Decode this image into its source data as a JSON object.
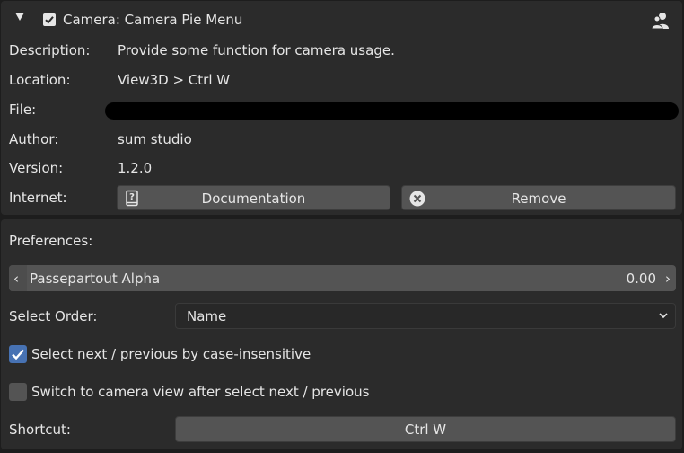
{
  "header": {
    "title": "Camera: Camera Pie Menu",
    "expanded": true,
    "enabled": true,
    "right_icon": "users-icon"
  },
  "info": {
    "description": {
      "label": "Description:",
      "value": "Provide some function for camera usage."
    },
    "location": {
      "label": "Location:",
      "value": "View3D > Ctrl W"
    },
    "file": {
      "label": "File:"
    },
    "author": {
      "label": "Author:",
      "value": "sum studio"
    },
    "version": {
      "label": "Version:",
      "value": "1.2.0"
    },
    "internet": {
      "label": "Internet:",
      "documentation_label": "Documentation",
      "documentation_icon": "help-doc-icon",
      "remove_label": "Remove",
      "remove_icon": "remove-x-icon"
    }
  },
  "preferences": {
    "title": "Preferences:",
    "passepartout": {
      "label": "Passepartout Alpha",
      "value": "0.00"
    },
    "select_order": {
      "label": "Select Order:",
      "value": "Name"
    },
    "case_insensitive": {
      "label": "Select next / previous by case-insensitive",
      "checked": true
    },
    "switch_camera_view": {
      "label": "Switch to camera view after select next / previous",
      "checked": false
    },
    "shortcut": {
      "label": "Shortcut:",
      "value": "Ctrl W"
    }
  },
  "colors": {
    "accent": "#4772b3",
    "panel_bg": "#2b2b2b",
    "button_bg": "#545454",
    "window_bg": "#1d1d1d"
  }
}
